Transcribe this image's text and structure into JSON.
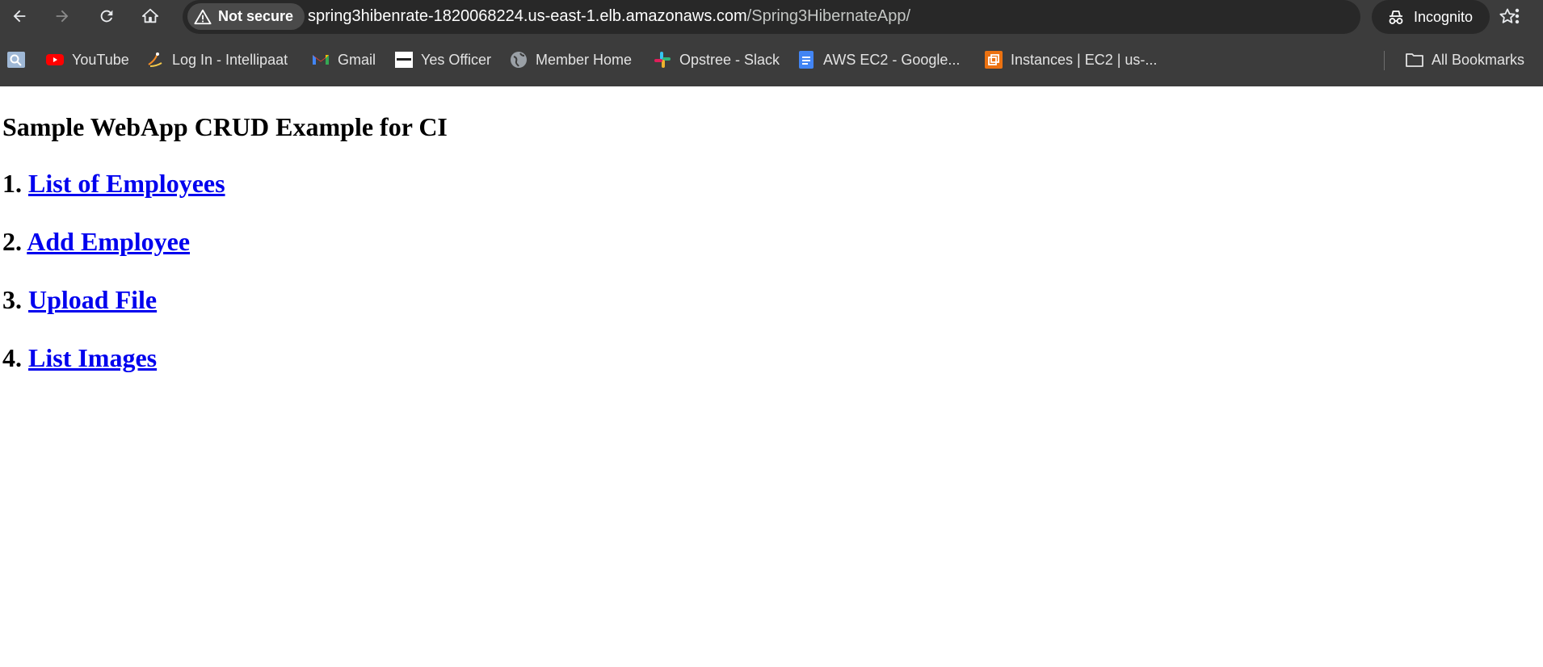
{
  "browser": {
    "security_label": "Not secure",
    "url_host": "spring3hibenrate-1820068224.us-east-1.elb.amazonaws.com",
    "url_path": "/Spring3HibernateApp/",
    "profile_label": "Incognito",
    "bookmarks": [
      {
        "label": "",
        "icon": "page-search-icon"
      },
      {
        "label": "YouTube",
        "icon": "youtube-icon"
      },
      {
        "label": "Log In - Intellipaat",
        "icon": "intellipaat-icon"
      },
      {
        "label": "Gmail",
        "icon": "gmail-icon"
      },
      {
        "label": "Yes Officer",
        "icon": "yes-officer-icon"
      },
      {
        "label": "Member Home",
        "icon": "globe-icon"
      },
      {
        "label": "Opstree - Slack",
        "icon": "slack-icon"
      },
      {
        "label": "AWS EC2 - Google...",
        "icon": "google-docs-icon"
      },
      {
        "label": "Instances | EC2 | us-...",
        "icon": "aws-ec2-icon"
      }
    ],
    "all_bookmarks_label": "All Bookmarks"
  },
  "page": {
    "title": "Sample WebApp CRUD Example for CI",
    "links": [
      {
        "number": "1.",
        "label": "List of Employees"
      },
      {
        "number": "2.",
        "label": "Add Employee"
      },
      {
        "number": "3.",
        "label": "Upload File"
      },
      {
        "number": "4.",
        "label": "List Images"
      }
    ]
  },
  "colors": {
    "chrome_bg": "#3c3c3c",
    "link": "#0000ee",
    "youtube_red": "#ff0000",
    "docs_blue": "#4285f4",
    "aws_orange": "#ec7211"
  }
}
